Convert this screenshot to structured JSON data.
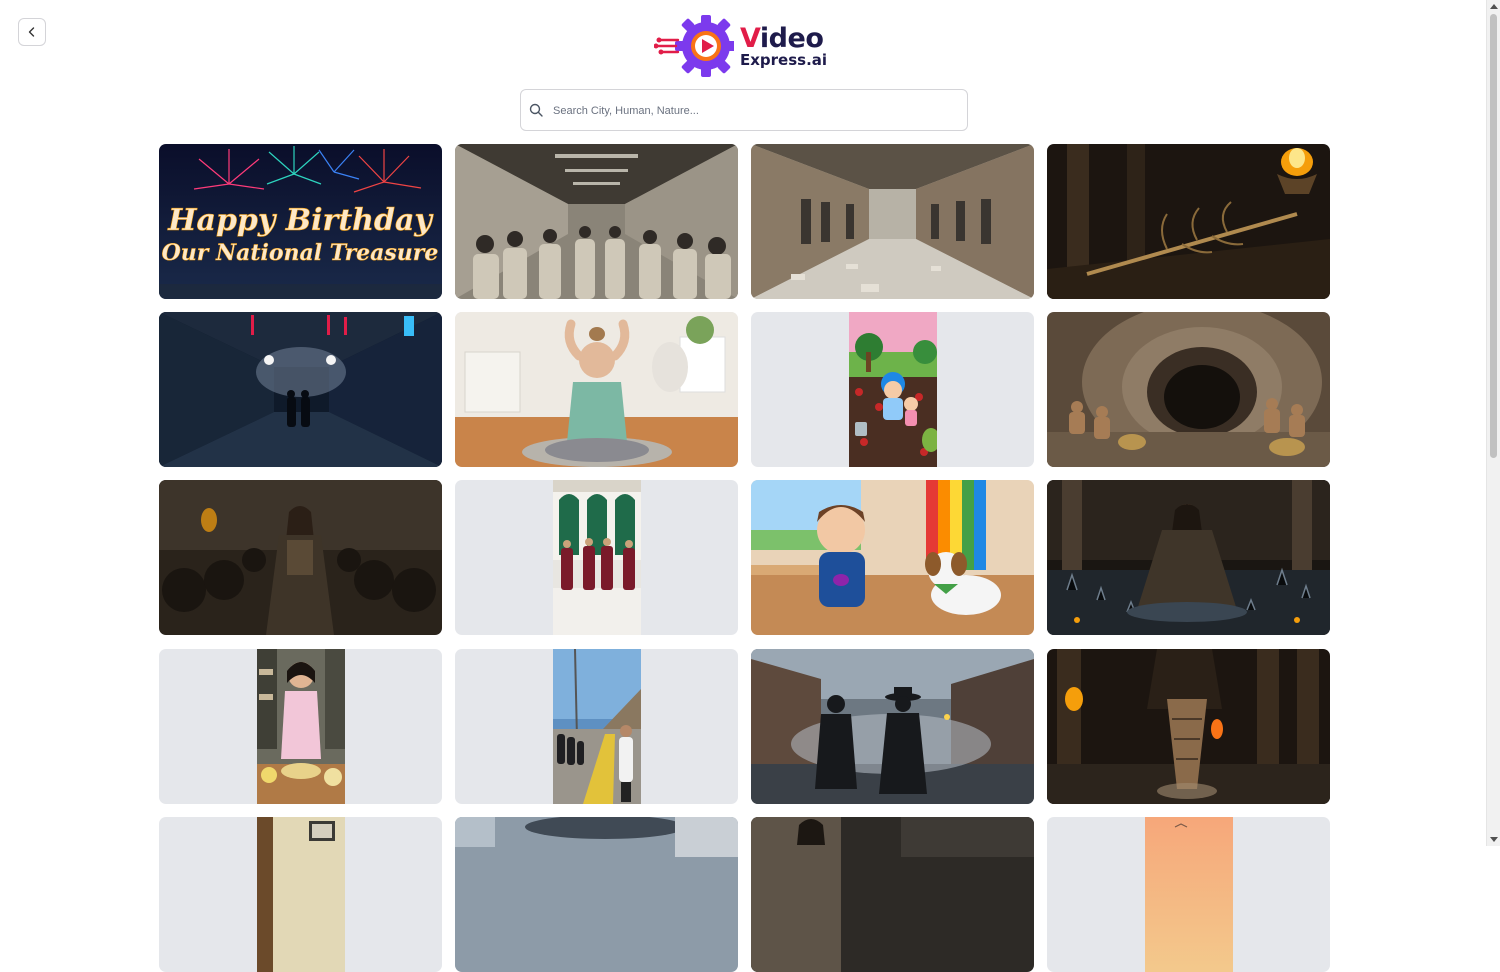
{
  "app": {
    "logo_line1_prefix": "V",
    "logo_line1_rest": "ideo",
    "logo_line2": "Express.ai"
  },
  "search": {
    "placeholder": "Search City, Human, Nature...",
    "value": ""
  },
  "icons": {
    "back": "chevron-left-icon",
    "search": "search-icon"
  },
  "colors": {
    "tile_placeholder": "#e5e7eb",
    "logo_dark": "#1e1b4b",
    "logo_accent": "#e11d48",
    "logo_gear": "#7c3aed"
  },
  "gallery": [
    {
      "subject": "fireworks-birthday",
      "orientation": "landscape",
      "caption_line1": "Happy Birthday",
      "caption_line2": "Our National Treasure"
    },
    {
      "subject": "crowd-corridor",
      "orientation": "landscape"
    },
    {
      "subject": "prison-hallway",
      "orientation": "landscape"
    },
    {
      "subject": "weapon-torch",
      "orientation": "landscape"
    },
    {
      "subject": "dark-corridor",
      "orientation": "landscape"
    },
    {
      "subject": "stressed-woman",
      "orientation": "landscape"
    },
    {
      "subject": "cartoon-farm",
      "orientation": "portrait"
    },
    {
      "subject": "cave-people",
      "orientation": "landscape"
    },
    {
      "subject": "warrior-queen",
      "orientation": "landscape"
    },
    {
      "subject": "mosque-guards",
      "orientation": "portrait"
    },
    {
      "subject": "cartoon-boy-dog",
      "orientation": "landscape"
    },
    {
      "subject": "warrior-water",
      "orientation": "landscape"
    },
    {
      "subject": "girl-cooking",
      "orientation": "portrait"
    },
    {
      "subject": "street-people",
      "orientation": "portrait"
    },
    {
      "subject": "two-men-street",
      "orientation": "landscape"
    },
    {
      "subject": "temple-feet",
      "orientation": "landscape"
    },
    {
      "subject": "room-sign",
      "orientation": "portrait"
    },
    {
      "subject": "sky-building",
      "orientation": "landscape"
    },
    {
      "subject": "woman-dark",
      "orientation": "landscape"
    },
    {
      "subject": "sunset",
      "orientation": "portrait"
    }
  ]
}
